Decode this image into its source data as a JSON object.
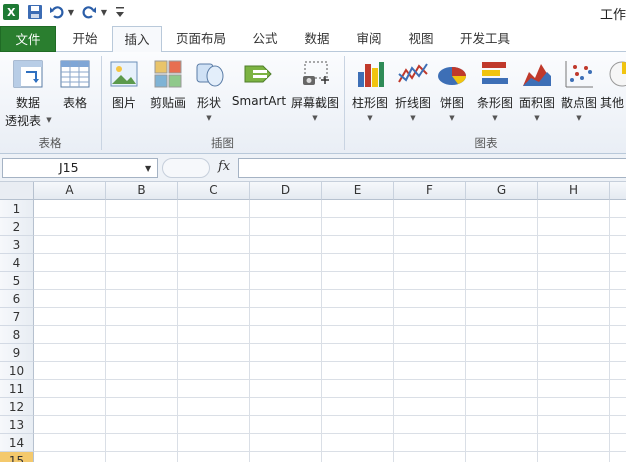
{
  "window": {
    "title_partial": "工作"
  },
  "qat": {
    "excel_icon": "excel-icon",
    "save_icon": "save-icon",
    "undo_icon": "undo-icon",
    "redo_icon": "redo-icon",
    "customize_icon": "customize-qat-icon"
  },
  "tabs": [
    {
      "label": "文件"
    },
    {
      "label": "开始"
    },
    {
      "label": "插入"
    },
    {
      "label": "页面布局"
    },
    {
      "label": "公式"
    },
    {
      "label": "数据"
    },
    {
      "label": "审阅"
    },
    {
      "label": "视图"
    },
    {
      "label": "开发工具"
    }
  ],
  "ribbon": {
    "groups": {
      "tables": {
        "label": "表格",
        "pivot_line1": "数据",
        "pivot_line2": "透视表",
        "table": "表格"
      },
      "illustrations": {
        "label": "插图",
        "picture": "图片",
        "clipart": "剪贴画",
        "shapes": "形状",
        "smartart": "SmartArt",
        "screenshot": "屏幕截图"
      },
      "charts": {
        "label": "图表",
        "column": "柱形图",
        "line": "折线图",
        "pie": "饼图",
        "bar": "条形图",
        "area": "面积图",
        "scatter": "散点图",
        "other": "其他"
      }
    }
  },
  "formula_bar": {
    "name_box": "J15",
    "fx": "fx",
    "formula": ""
  },
  "sheet": {
    "columns": [
      "A",
      "B",
      "C",
      "D",
      "E",
      "F",
      "G",
      "H"
    ],
    "rows": [
      "1",
      "2",
      "3",
      "4",
      "5",
      "6",
      "7",
      "8",
      "9",
      "10",
      "11",
      "12",
      "13",
      "14",
      "15"
    ],
    "active_row": "15",
    "active_cell": "J15"
  },
  "colors": {
    "file_tab": "#2a7e2f",
    "ribbon_bg": "#eef2f7",
    "active_row_header": "#f4c96c"
  }
}
